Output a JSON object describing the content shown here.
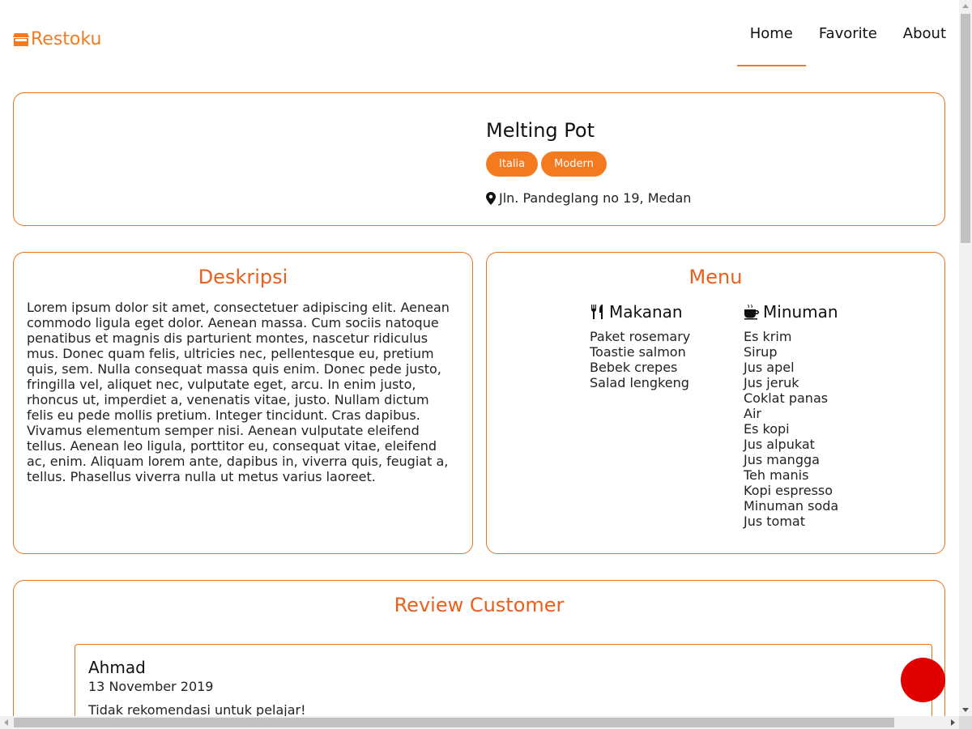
{
  "header": {
    "logo_text": "Restoku",
    "logo_icon": "store-icon",
    "nav": [
      {
        "label": "Home",
        "active": true
      },
      {
        "label": "Favorite",
        "active": false
      },
      {
        "label": "About",
        "active": false
      }
    ]
  },
  "restaurant": {
    "name": "Melting Pot",
    "categories": [
      "Italia",
      "Modern"
    ],
    "address": "Jln. Pandeglang no 19, Medan",
    "address_icon": "map-pin-icon"
  },
  "description": {
    "title": "Deskripsi",
    "text": "Lorem ipsum dolor sit amet, consectetuer adipiscing elit. Aenean commodo ligula eget dolor. Aenean massa. Cum sociis natoque penatibus et magnis dis parturient montes, nascetur ridiculus mus. Donec quam felis, ultricies nec, pellentesque eu, pretium quis, sem. Nulla consequat massa quis enim. Donec pede justo, fringilla vel, aliquet nec, vulputate eget, arcu. In enim justo, rhoncus ut, imperdiet a, venenatis vitae, justo. Nullam dictum felis eu pede mollis pretium. Integer tincidunt. Cras dapibus. Vivamus elementum semper nisi. Aenean vulputate eleifend tellus. Aenean leo ligula, porttitor eu, consequat vitae, eleifend ac, enim. Aliquam lorem ante, dapibus in, viverra quis, feugiat a, tellus. Phasellus viverra nulla ut metus varius laoreet."
  },
  "menu": {
    "title": "Menu",
    "foods": {
      "title": "Makanan",
      "icon": "utensils-icon",
      "items": [
        "Paket rosemary",
        "Toastie salmon",
        "Bebek crepes",
        "Salad lengkeng"
      ]
    },
    "drinks": {
      "title": "Minuman",
      "icon": "mug-icon",
      "items": [
        "Es krim",
        "Sirup",
        "Jus apel",
        "Jus jeruk",
        "Coklat panas",
        "Air",
        "Es kopi",
        "Jus alpukat",
        "Jus mangga",
        "Teh manis",
        "Kopi espresso",
        "Minuman soda",
        "Jus tomat"
      ]
    }
  },
  "reviews": {
    "title": "Review Customer",
    "items": [
      {
        "name": "Ahmad",
        "date": "13 November 2019",
        "review": "Tidak rekomendasi untuk pelajar!"
      }
    ]
  },
  "colors": {
    "accent": "#f47a20",
    "title_orange": "#e8601c",
    "fab_red": "#e00000"
  }
}
